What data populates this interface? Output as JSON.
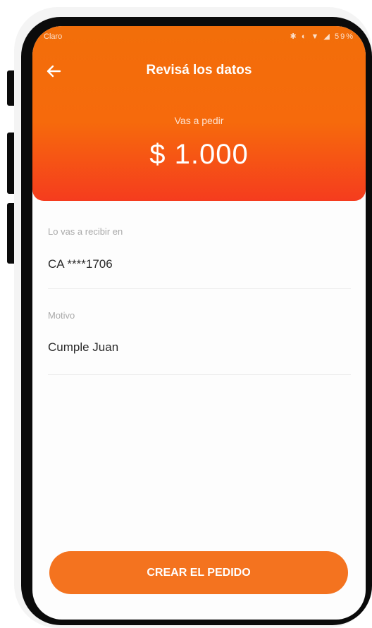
{
  "status_bar": {
    "carrier": "Claro",
    "icons": "✱ ◐ ▼ ◢",
    "battery": "59%"
  },
  "header": {
    "back_icon": "arrow-left-icon",
    "title": "Revisá los datos",
    "subtitle": "Vas a pedir",
    "amount": "$ 1.000"
  },
  "fields": [
    {
      "label": "Lo vas a recibir en",
      "value": "CA ****1706"
    },
    {
      "label": "Motivo",
      "value": "Cumple Juan"
    }
  ],
  "actions": {
    "create_label": "CREAR EL PEDIDO"
  },
  "colors": {
    "header_top": "#f26e0a",
    "header_bottom": "#f53c1e",
    "button": "#f4731f"
  }
}
